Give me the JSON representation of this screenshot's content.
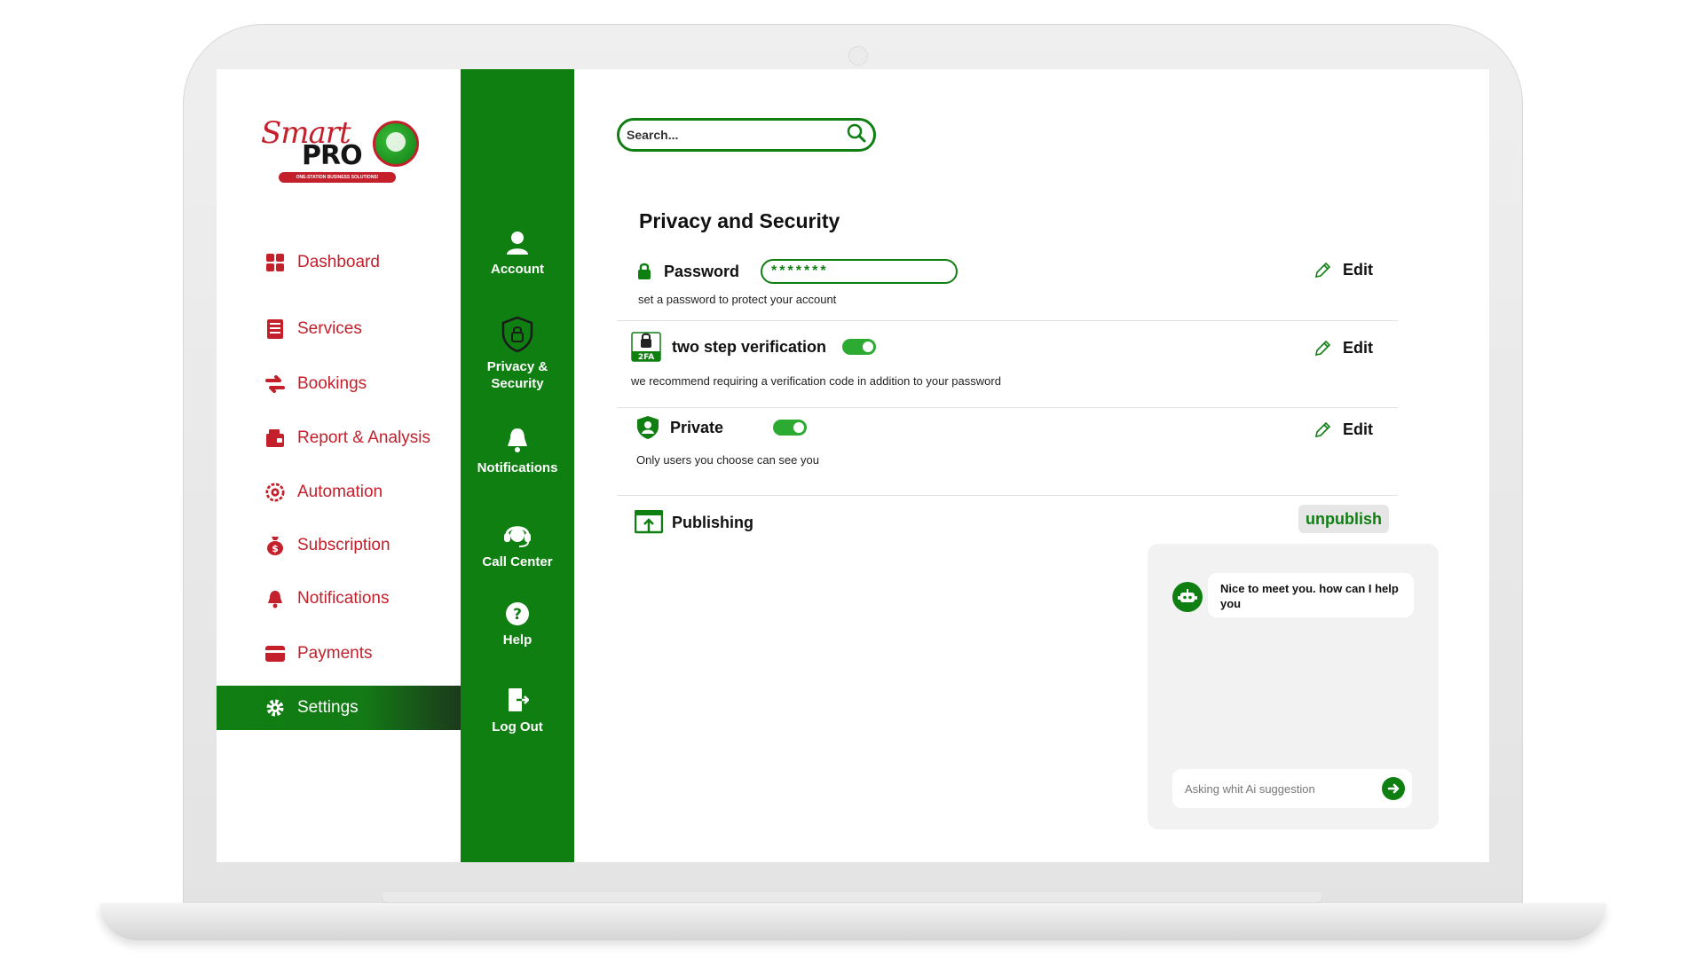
{
  "brand": {
    "logo_script": "Smart",
    "logo_bold": "PRO",
    "tagline": "ONE-STATION BUSINESS SOLUTIONS!",
    "color_primary": "#0f7f12",
    "color_accent": "#c4202b"
  },
  "sidebar": {
    "items": [
      {
        "label": "Dashboard",
        "icon": "dashboard-grid-icon"
      },
      {
        "label": "Services",
        "icon": "services-list-icon"
      },
      {
        "label": "Bookings",
        "icon": "bookings-arrows-icon"
      },
      {
        "label": "Report & Analysis",
        "icon": "report-wallet-icon"
      },
      {
        "label": "Automation",
        "icon": "automation-gear-icon"
      },
      {
        "label": "Subscription",
        "icon": "money-bag-icon"
      },
      {
        "label": "Notifications",
        "icon": "bell-icon"
      },
      {
        "label": "Payments",
        "icon": "card-icon"
      },
      {
        "label": "Settings",
        "icon": "gear-icon",
        "active": true
      }
    ]
  },
  "rail": {
    "items": [
      {
        "label": "Account",
        "icon": "user-icon"
      },
      {
        "label": "Privacy & Security",
        "icon": "shield-lock-icon"
      },
      {
        "label": "Notifications",
        "icon": "bell-icon"
      },
      {
        "label": "Call Center",
        "icon": "headset-icon"
      },
      {
        "label": "Help",
        "icon": "question-icon"
      },
      {
        "label": "Log Out",
        "icon": "logout-icon"
      }
    ]
  },
  "search": {
    "placeholder": "Search..."
  },
  "privacy": {
    "title": "Privacy and Security",
    "password": {
      "label": "Password",
      "value": "*******",
      "description": "set a password to protect your account",
      "edit_label": "Edit"
    },
    "two_step": {
      "label": "two step verification",
      "badge": "2FA",
      "enabled": true,
      "description": "we recommend requiring a verification code in addition to your password",
      "edit_label": "Edit"
    },
    "private": {
      "label": "Private",
      "enabled": true,
      "description": "Only users you choose can see you",
      "edit_label": "Edit"
    },
    "publishing": {
      "label": "Publishing",
      "action_label": "unpublish"
    }
  },
  "chat": {
    "bot_message": "Nice to meet you. how can I help you",
    "input_placeholder": "Asking whit Ai suggestion"
  }
}
